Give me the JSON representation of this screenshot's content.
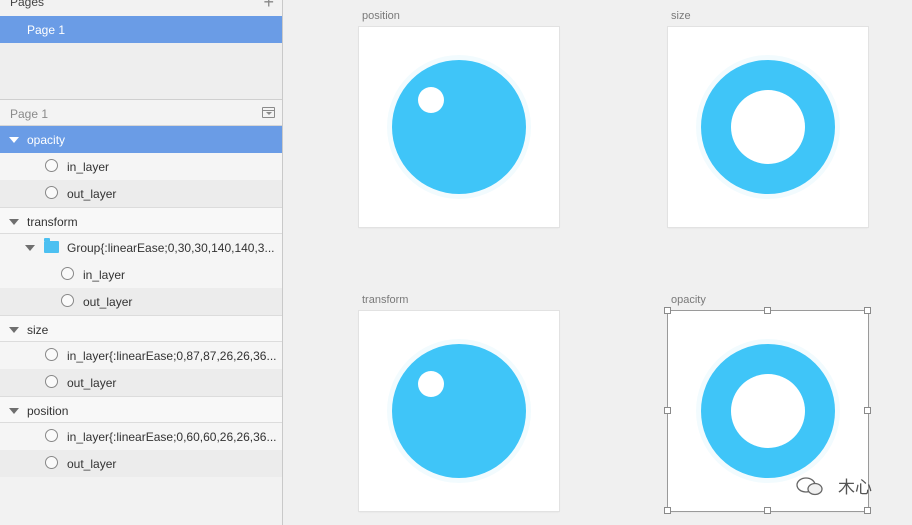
{
  "sidebar": {
    "pages_title": "Pages",
    "add_page_symbol": "+",
    "current_page": "Page 1",
    "layers_header": "Page 1",
    "layers": [
      {
        "label": "opacity",
        "kind": "group"
      },
      {
        "label": "in_layer",
        "kind": "leaf"
      },
      {
        "label": "out_layer",
        "kind": "leaf"
      },
      {
        "label": "transform",
        "kind": "group"
      },
      {
        "label": "Group{:linearEase;0,30,30,140,140,3...",
        "kind": "folder"
      },
      {
        "label": "in_layer",
        "kind": "leaf"
      },
      {
        "label": "out_layer",
        "kind": "leaf"
      },
      {
        "label": "size",
        "kind": "group"
      },
      {
        "label": "in_layer{:linearEase;0,87,87,26,26,36...",
        "kind": "leaf"
      },
      {
        "label": "out_layer",
        "kind": "leaf"
      },
      {
        "label": "position",
        "kind": "group"
      },
      {
        "label": "in_layer{:linearEase;0,60,60,26,26,36...",
        "kind": "leaf"
      },
      {
        "label": "out_layer",
        "kind": "leaf"
      }
    ]
  },
  "artboards": [
    {
      "label": "position"
    },
    {
      "label": "size"
    },
    {
      "label": "transform"
    },
    {
      "label": "opacity"
    }
  ],
  "colors": {
    "accent_blue": "#6a9ce6",
    "circle_blue": "#3fc5f8",
    "folder_blue": "#4cc0f1"
  },
  "watermark": "木心"
}
